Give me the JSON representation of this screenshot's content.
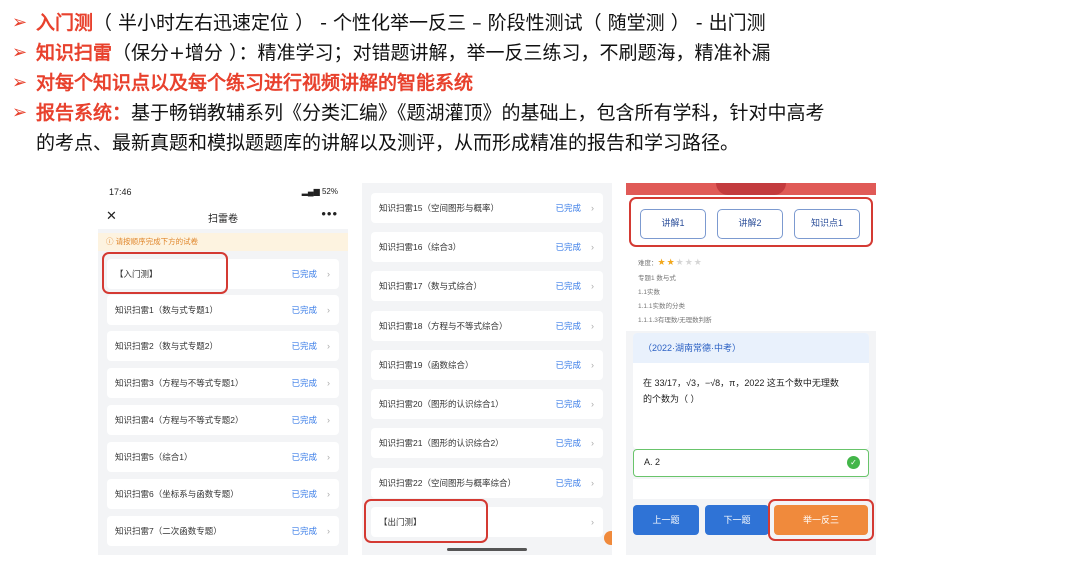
{
  "bullets": [
    {
      "highlight": "入门测",
      "text": "（ 半小时左右迅速定位 ） - 个性化举一反三 – 阶段性测试（ 随堂测 ） - 出门测"
    },
    {
      "highlight": "知识扫雷",
      "text": "（保分+增分 ）：精准学习；对错题讲解，举一反三练习，不刷题海，精准补漏"
    },
    {
      "highlight": "对每个知识点以及每个练习进行视频讲解的智能系统",
      "text": ""
    },
    {
      "highlight": "报告系统：",
      "text": "基于畅销教辅系列《分类汇编》《题湖灌顶》的基础上，包含所有学科，针对中高考"
    },
    {
      "highlight": "",
      "text": "的考点、最新真题和模拟题题库的讲解以及测评，从而形成精准的报告和学习路径。"
    }
  ],
  "phone1": {
    "status_time": "17:46",
    "status_right": "52%",
    "title": "扫雷卷",
    "notice": "请按顺序完成下方的试卷",
    "items": [
      {
        "label": "【入门测】",
        "status": "已完成"
      },
      {
        "label": "知识扫雷1（数与式专题1）",
        "status": "已完成"
      },
      {
        "label": "知识扫雷2（数与式专题2）",
        "status": "已完成"
      },
      {
        "label": "知识扫雷3（方程与不等式专题1）",
        "status": "已完成"
      },
      {
        "label": "知识扫雷4（方程与不等式专题2）",
        "status": "已完成"
      },
      {
        "label": "知识扫雷5（综合1）",
        "status": "已完成"
      },
      {
        "label": "知识扫雷6（坐标系与函数专题）",
        "status": "已完成"
      },
      {
        "label": "知识扫雷7（二次函数专题）",
        "status": "已完成"
      }
    ]
  },
  "phone2": {
    "items": [
      {
        "label": "知识扫雷15（空间图形与概率）",
        "status": "已完成"
      },
      {
        "label": "知识扫雷16（综合3）",
        "status": "已完成"
      },
      {
        "label": "知识扫雷17（数与式综合）",
        "status": "已完成"
      },
      {
        "label": "知识扫雷18（方程与不等式综合）",
        "status": "已完成"
      },
      {
        "label": "知识扫雷19（函数综合）",
        "status": "已完成"
      },
      {
        "label": "知识扫雷20（图形的认识综合1）",
        "status": "已完成"
      },
      {
        "label": "知识扫雷21（图形的认识综合2）",
        "status": "已完成"
      },
      {
        "label": "知识扫雷22（空间图形与概率综合）",
        "status": "已完成"
      },
      {
        "label": "【出门测】",
        "status": ""
      }
    ]
  },
  "phone3": {
    "tabs": [
      "讲解1",
      "讲解2",
      "知识点1"
    ],
    "difficulty_label": "难度：",
    "difficulty_stars": 2,
    "topics": [
      "专题1 数与式",
      "1.1实数",
      "1.1.1实数的分类",
      "1.1.1.3有理数/无理数判断"
    ],
    "question_source": "（2022·湖南常德·中考）",
    "question_line1": "在 33/17，√3，−√8，π，2022   这五个数中无理数",
    "question_line2": "的个数为（    ）",
    "answer": "A. 2",
    "btn_prev": "上一题",
    "btn_next": "下一题",
    "btn_more": "举一反三"
  },
  "colors": {
    "accent_red": "#e8412d",
    "done_blue": "#3a7de8",
    "btn_blue": "#2f73d6",
    "btn_orange": "#f08a3c"
  }
}
